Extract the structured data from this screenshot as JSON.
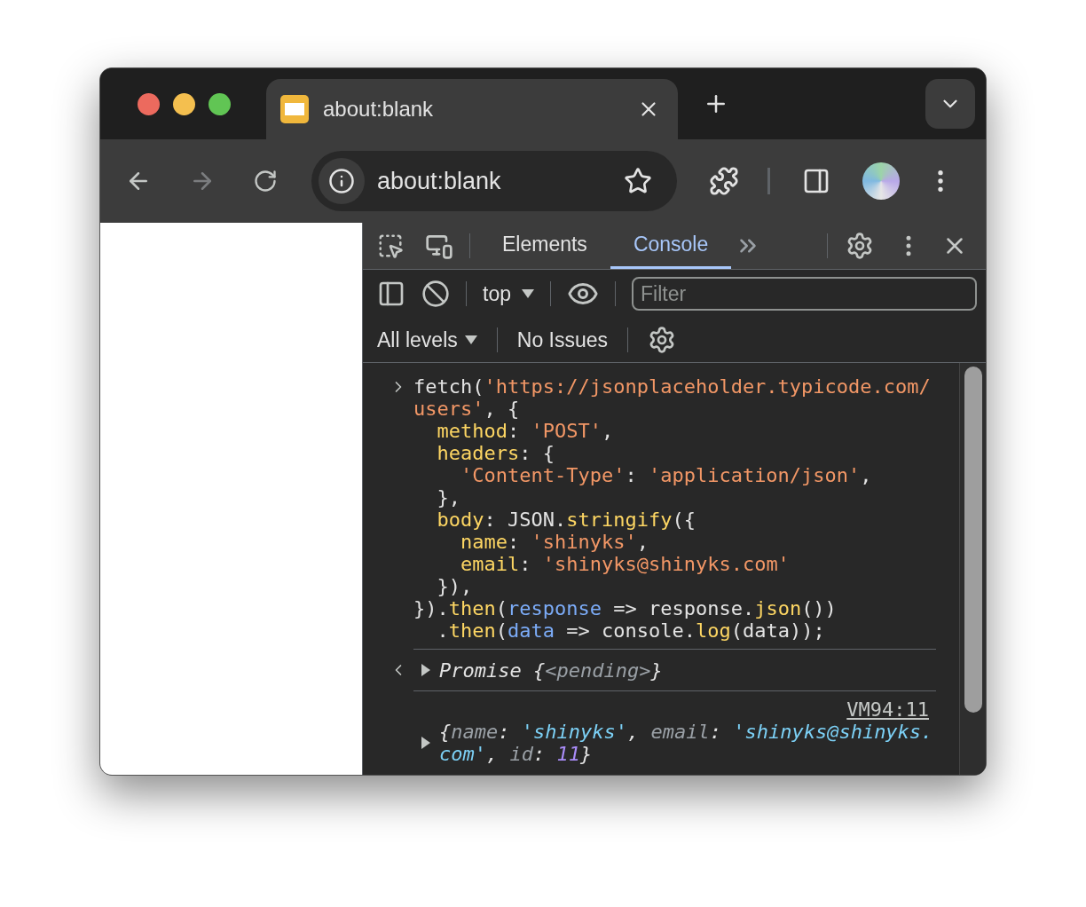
{
  "browser_tabs": [
    {
      "title": "about:blank",
      "selected": true
    }
  ],
  "address_bar": {
    "value": "about:blank"
  },
  "devtools": {
    "tabs": [
      {
        "label": "Elements",
        "selected": false
      },
      {
        "label": "Console",
        "selected": true
      }
    ],
    "context": "top",
    "filter": {
      "placeholder": "Filter"
    },
    "levels": "All levels",
    "issues": "No Issues",
    "input_lines": [
      [
        {
          "kind": "plain",
          "text": "fetch("
        },
        {
          "kind": "string",
          "text": "'https://jsonplaceholder.typicode.com/"
        }
      ],
      [
        {
          "kind": "string",
          "text": "users'"
        },
        {
          "kind": "plain",
          "text": ", {"
        }
      ],
      [
        {
          "kind": "key",
          "text": "  method"
        },
        {
          "kind": "plain",
          "text": ": "
        },
        {
          "kind": "string",
          "text": "'POST'"
        },
        {
          "kind": "plain",
          "text": ","
        }
      ],
      [
        {
          "kind": "key",
          "text": "  headers"
        },
        {
          "kind": "plain",
          "text": ": {"
        }
      ],
      [
        {
          "kind": "string",
          "text": "    'Content-Type'"
        },
        {
          "kind": "plain",
          "text": ": "
        },
        {
          "kind": "string",
          "text": "'application/json'"
        },
        {
          "kind": "plain",
          "text": ","
        }
      ],
      [
        {
          "kind": "plain",
          "text": "  },"
        }
      ],
      [
        {
          "kind": "key",
          "text": "  body"
        },
        {
          "kind": "plain",
          "text": ": JSON."
        },
        {
          "kind": "key",
          "text": "stringify"
        },
        {
          "kind": "plain",
          "text": "({"
        }
      ],
      [
        {
          "kind": "key",
          "text": "    name"
        },
        {
          "kind": "plain",
          "text": ": "
        },
        {
          "kind": "string",
          "text": "'shinyks'"
        },
        {
          "kind": "plain",
          "text": ","
        }
      ],
      [
        {
          "kind": "key",
          "text": "    email"
        },
        {
          "kind": "plain",
          "text": ": "
        },
        {
          "kind": "string",
          "text": "'shinyks@shinyks.com'"
        }
      ],
      [
        {
          "kind": "plain",
          "text": "  }),"
        }
      ],
      [
        {
          "kind": "plain",
          "text": "})."
        },
        {
          "kind": "key",
          "text": "then"
        },
        {
          "kind": "plain",
          "text": "("
        },
        {
          "kind": "param",
          "text": "response"
        },
        {
          "kind": "plain",
          "text": " => response."
        },
        {
          "kind": "key",
          "text": "json"
        },
        {
          "kind": "plain",
          "text": "())"
        }
      ],
      [
        {
          "kind": "plain",
          "text": "  ."
        },
        {
          "kind": "key",
          "text": "then"
        },
        {
          "kind": "plain",
          "text": "("
        },
        {
          "kind": "param",
          "text": "data"
        },
        {
          "kind": "plain",
          "text": " => console."
        },
        {
          "kind": "key",
          "text": "log"
        },
        {
          "kind": "plain",
          "text": "(data));"
        }
      ]
    ],
    "result": [
      {
        "kind": "name",
        "text": "Promise "
      },
      {
        "kind": "plain",
        "text": "{"
      },
      {
        "kind": "dim",
        "text": "<pending>"
      },
      {
        "kind": "plain",
        "text": "}"
      }
    ],
    "log": {
      "source": "VM94:11",
      "value": [
        {
          "kind": "plain",
          "text": "{"
        },
        {
          "kind": "dim",
          "text": "name"
        },
        {
          "kind": "plain",
          "text": ": "
        },
        {
          "kind": "str",
          "text": "'shinyks'"
        },
        {
          "kind": "plain",
          "text": ", "
        },
        {
          "kind": "dim",
          "text": "email"
        },
        {
          "kind": "plain",
          "text": ": "
        },
        {
          "kind": "str",
          "text": "'shinyks@shinyks.com'"
        },
        {
          "kind": "plain",
          "text": ", "
        },
        {
          "kind": "dim",
          "text": "id"
        },
        {
          "kind": "plain",
          "text": ": "
        },
        {
          "kind": "num",
          "text": "11"
        },
        {
          "kind": "plain",
          "text": "}"
        }
      ]
    }
  }
}
